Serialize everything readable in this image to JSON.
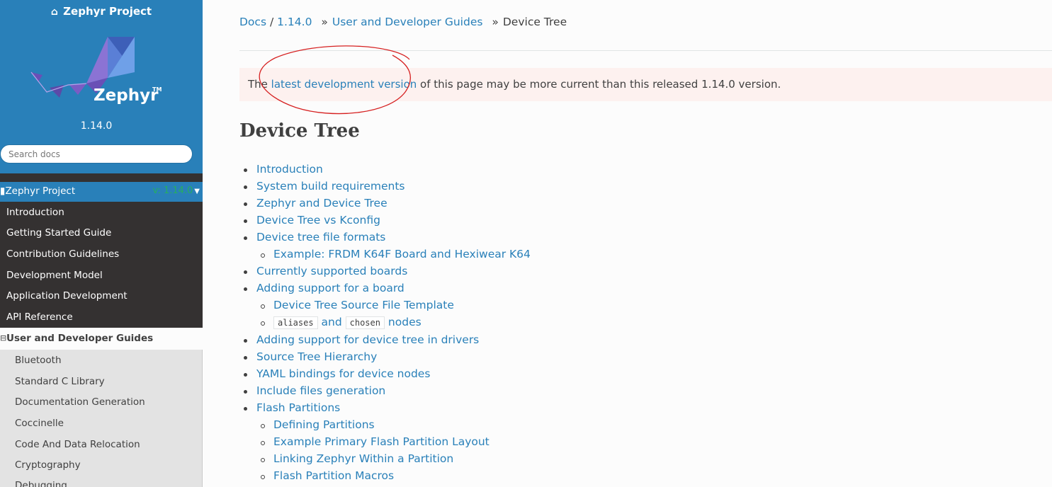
{
  "sidebar": {
    "project_link": "Zephyr Project",
    "logo_text": "Zephyr",
    "logo_tm": "TM",
    "version": "1.14.0",
    "search_placeholder": "Search docs",
    "project_row": {
      "label": "Zephyr Project",
      "version": "v: 1.14.0"
    },
    "nav": [
      "Introduction",
      "Getting Started Guide",
      "Contribution Guidelines",
      "Development Model",
      "Application Development",
      "API Reference"
    ],
    "current_section": "User and Developer Guides",
    "sub_items": [
      "Bluetooth",
      "Standard C Library",
      "Documentation Generation",
      "Coccinelle",
      "Code And Data Relocation",
      "Cryptography",
      "Debugging"
    ]
  },
  "breadcrumb": {
    "docs": "Docs",
    "version": "1.14.0",
    "guides": "User and Developer Guides",
    "current": "Device Tree"
  },
  "note": {
    "prefix": "The ",
    "link": "latest development version",
    "suffix": " of this page may be more current than this released 1.14.0 version."
  },
  "page_title": "Device Tree",
  "toc": [
    {
      "text": "Introduction",
      "level": 1
    },
    {
      "text": "System build requirements",
      "level": 1
    },
    {
      "text": "Zephyr and Device Tree",
      "level": 1
    },
    {
      "text": "Device Tree vs Kconfig",
      "level": 1
    },
    {
      "text": "Device tree file formats",
      "level": 1
    },
    {
      "text": "Example: FRDM K64F Board and Hexiwear K64",
      "level": 2
    },
    {
      "text": "Currently supported boards",
      "level": 1
    },
    {
      "text": "Adding support for a board",
      "level": 1
    },
    {
      "text": "Device Tree Source File Template",
      "level": 2
    },
    {
      "text": "aliases|and|chosen|nodes",
      "level": 2
    },
    {
      "text": "Adding support for device tree in drivers",
      "level": 1
    },
    {
      "text": "Source Tree Hierarchy",
      "level": 1
    },
    {
      "text": "YAML bindings for device nodes",
      "level": 1
    },
    {
      "text": "Include files generation",
      "level": 1
    },
    {
      "text": "Flash Partitions",
      "level": 1
    },
    {
      "text": "Defining Partitions",
      "level": 2
    },
    {
      "text": "Example Primary Flash Partition Layout",
      "level": 2
    },
    {
      "text": "Linking Zephyr Within a Partition",
      "level": 2
    },
    {
      "text": "Flash Partition Macros",
      "level": 2
    }
  ],
  "toc_code": {
    "aliases": "aliases",
    "and": "and",
    "chosen": "chosen",
    "nodes": "nodes"
  },
  "colors": {
    "sidebar_top": "#2980b9",
    "sidebar_nav": "#343131",
    "link": "#2980b9",
    "note_bg": "#fdf1ef",
    "annotation": "#d62020"
  },
  "icons": {
    "home": "home-icon",
    "caret": "caret-down-icon",
    "collapse": "minus-square-icon"
  }
}
